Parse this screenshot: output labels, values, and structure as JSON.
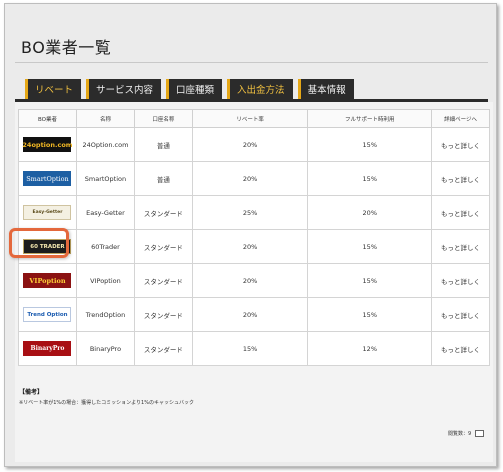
{
  "page": {
    "title": "BO業者一覧"
  },
  "tabs": [
    {
      "label": "リベート",
      "active": true
    },
    {
      "label": "サービス内容",
      "active": false
    },
    {
      "label": "口座種類",
      "active": false
    },
    {
      "label": "入出金方法",
      "active": true
    },
    {
      "label": "基本情報",
      "active": false
    }
  ],
  "table": {
    "headers": [
      "BO業者",
      "名称",
      "口座名称",
      "リベート率",
      "フルサポート時利用",
      "詳細ページへ"
    ],
    "rows": [
      {
        "logo": "24option.com",
        "name": "24Option.com",
        "account": "普通",
        "rebate": "20%",
        "full": "15%",
        "link": "もっと詳しく"
      },
      {
        "logo": "SmartOption",
        "name": "SmartOption",
        "account": "普通",
        "rebate": "20%",
        "full": "15%",
        "link": "もっと詳しく"
      },
      {
        "logo": "Easy-Getter",
        "name": "Easy-Getter",
        "account": "スタンダード",
        "rebate": "25%",
        "full": "20%",
        "link": "もっと詳しく"
      },
      {
        "logo": "60 TRADER",
        "name": "60Trader",
        "account": "スタンダード",
        "rebate": "20%",
        "full": "15%",
        "link": "もっと詳しく"
      },
      {
        "logo": "VIPoption",
        "name": "VIPoption",
        "account": "スタンダード",
        "rebate": "20%",
        "full": "15%",
        "link": "もっと詳しく"
      },
      {
        "logo": "Trend Option",
        "name": "TrendOption",
        "account": "スタンダード",
        "rebate": "20%",
        "full": "15%",
        "link": "もっと詳しく"
      },
      {
        "logo": "BinaryPro",
        "name": "BinaryPro",
        "account": "スタンダード",
        "rebate": "15%",
        "full": "12%",
        "link": "もっと詳しく"
      }
    ]
  },
  "notes": {
    "title": "【備考】",
    "text": "※リベート率が1%の場合：獲得したコミッションより1%のキャッシュバック"
  },
  "page_view": {
    "label": "閲覧数：9"
  },
  "colors": {
    "tab_bg": "#2b2b2b",
    "tab_accent": "#e6a817",
    "highlight": "#e4683c"
  }
}
